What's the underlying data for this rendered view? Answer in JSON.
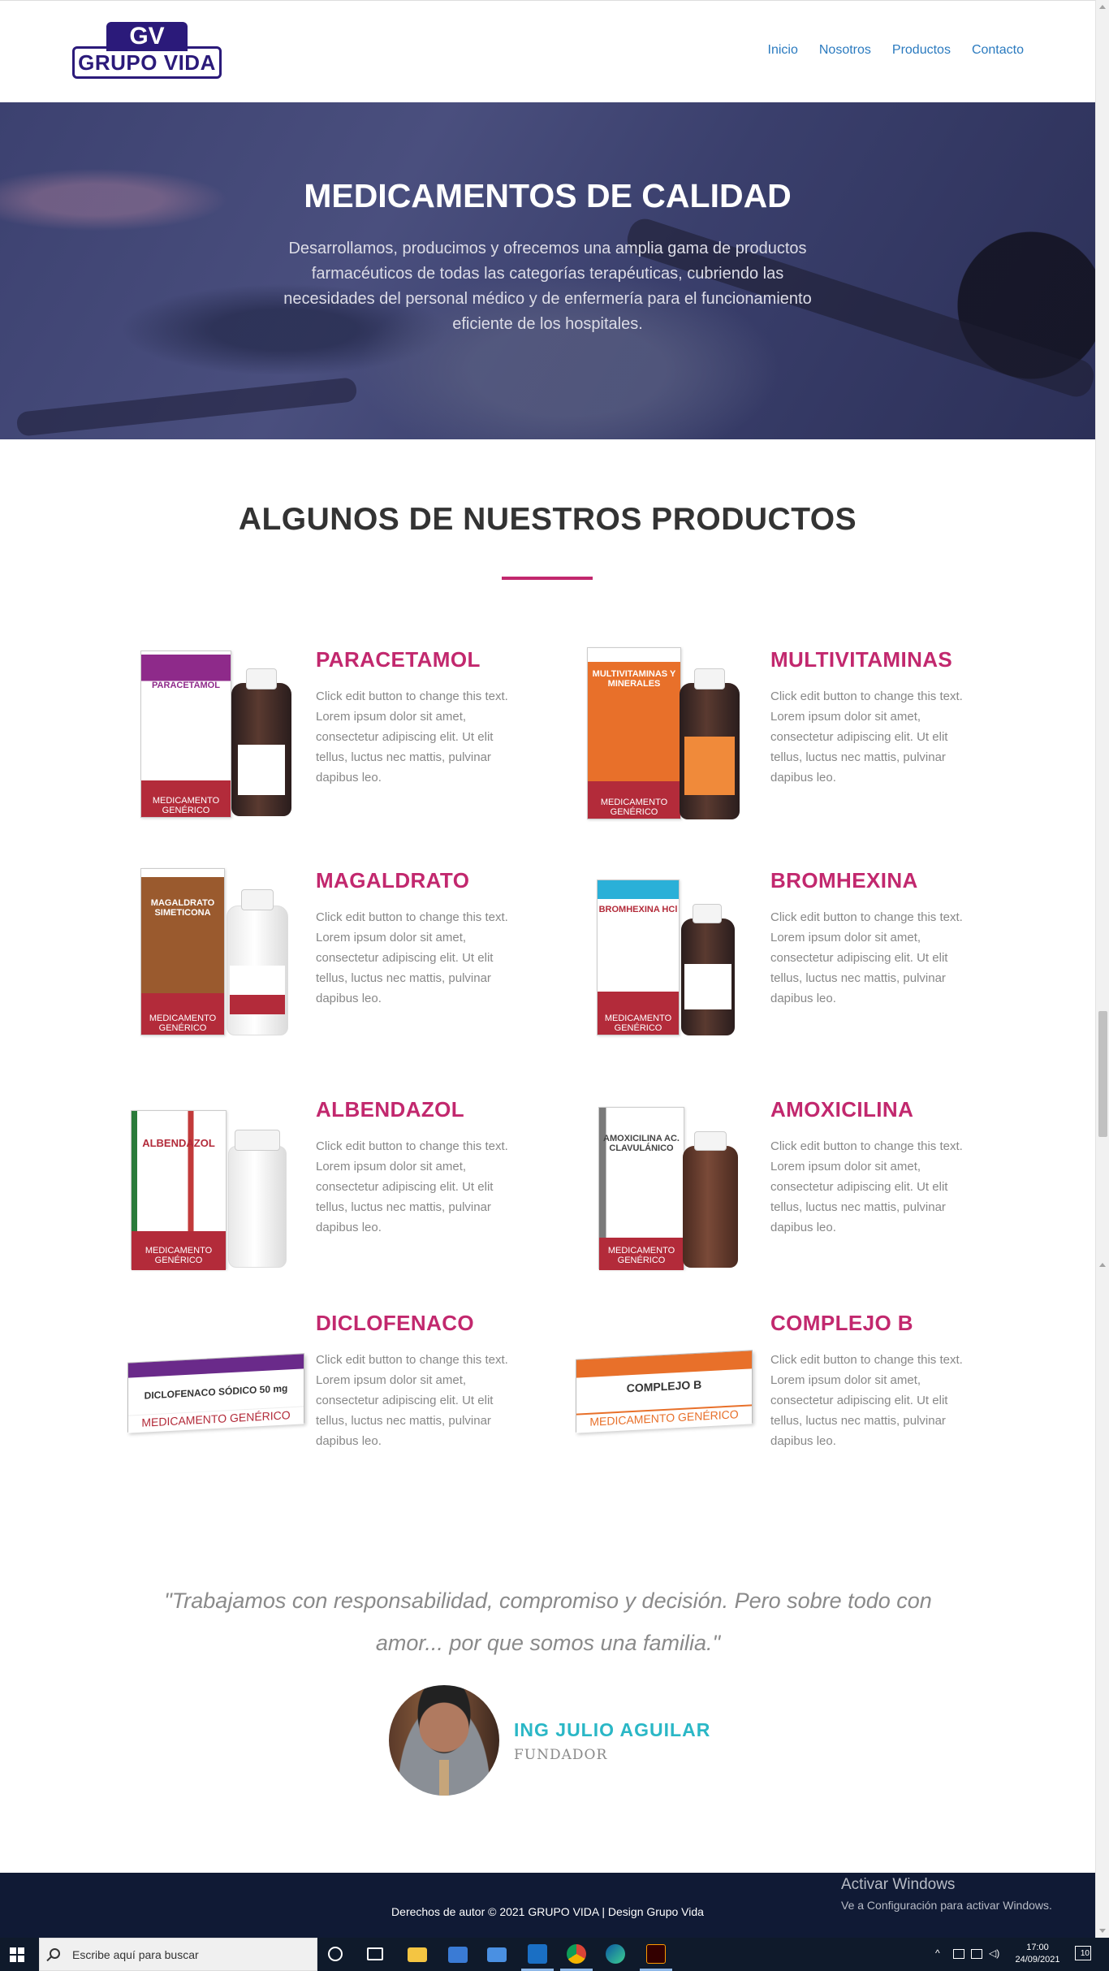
{
  "header": {
    "logo_initials": "GV",
    "logo_text": "GRUPO VIDA",
    "nav": [
      "Inicio",
      "Nosotros",
      "Productos",
      "Contacto"
    ]
  },
  "hero": {
    "title": "MEDICAMENTOS DE CALIDAD",
    "description": "Desarrollamos, producimos y ofrecemos una amplia gama de productos farmacéuticos de todas las categorías terapéuticas, cubriendo las necesidades del personal médico y de enfermería para el funcionamiento eficiente de los hospitales."
  },
  "products_section": {
    "title": "ALGUNOS DE NUESTROS PRODUCTOS",
    "items": [
      {
        "name": "PARACETAMOL",
        "description": "Click edit button to change this text. Lorem ipsum dolor sit amet, consectetur adipiscing elit. Ut elit tellus, luctus nec mattis, pulvinar dapibus leo.",
        "box_label": "PARACETAMOL",
        "color": "#8e2a8a"
      },
      {
        "name": "MULTIVITAMINAS",
        "description": "Click edit button to change this text. Lorem ipsum dolor sit amet, consectetur adipiscing elit. Ut elit tellus, luctus nec mattis, pulvinar dapibus leo.",
        "box_label": "MULTIVITAMINAS Y MINERALES",
        "color": "#e8702a"
      },
      {
        "name": "MAGALDRATO",
        "description": "Click edit button to change this text. Lorem ipsum dolor sit amet, consectetur adipiscing elit. Ut elit tellus, luctus nec mattis, pulvinar dapibus leo.",
        "box_label": "MAGALDRATO SIMETICONA",
        "color": "#9a5a2e"
      },
      {
        "name": "BROMHEXINA",
        "description": "Click edit button to change this text. Lorem ipsum dolor sit amet, consectetur adipiscing elit. Ut elit tellus, luctus nec mattis, pulvinar dapibus leo.",
        "box_label": "BROMHEXINA HCl",
        "color": "#2ab0d8"
      },
      {
        "name": "ALBENDAZOL",
        "description": "Click edit button to change this text. Lorem ipsum dolor sit amet, consectetur adipiscing elit. Ut elit tellus, luctus nec mattis, pulvinar dapibus leo.",
        "box_label": "ALBENDAZOL",
        "color": "#2a7a3a"
      },
      {
        "name": "AMOXICILINA",
        "description": "Click edit button to change this text. Lorem ipsum dolor sit amet, consectetur adipiscing elit. Ut elit tellus, luctus nec mattis, pulvinar dapibus leo.",
        "box_label": "AMOXICILINA AC. CLAVULÁNICO",
        "color": "#7a7a7a"
      },
      {
        "name": "DICLOFENACO",
        "description": "Click edit button to change this text. Lorem ipsum dolor sit amet, consectetur adipiscing elit. Ut elit tellus, luctus nec mattis, pulvinar dapibus leo.",
        "box_label": "DICLOFENACO SÓDICO 50 mg",
        "color": "#6a2a8a"
      },
      {
        "name": "COMPLEJO B",
        "description": "Click edit button to change this text. Lorem ipsum dolor sit amet, consectetur adipiscing elit. Ut elit tellus, luctus nec mattis, pulvinar dapibus leo.",
        "box_label": "COMPLEJO B",
        "color": "#e8702a"
      }
    ],
    "generic_label": "MEDICAMENTO GENÉRICO"
  },
  "testimonial": {
    "quote": "\"Trabajamos con responsabilidad, compromiso y decisión. Pero sobre todo con amor... por que somos una familia.\"",
    "name": "ING JULIO AGUILAR",
    "role": "FUNDADOR"
  },
  "footer": {
    "text": "Derechos de autor © 2021 GRUPO VIDA | Design Grupo Vida"
  },
  "windows_watermark": {
    "title": "Activar Windows",
    "subtitle": "Ve a Configuración para activar Windows."
  },
  "taskbar": {
    "search_placeholder": "Escribe aquí para buscar",
    "time": "17:00",
    "date": "24/09/2021",
    "notification_count": "10",
    "icons": [
      "cortana-icon",
      "task-view-icon",
      "file-explorer-icon",
      "store-icon",
      "mail-icon",
      "outlook-icon",
      "chrome-icon",
      "edge-icon",
      "illustrator-icon"
    ]
  }
}
